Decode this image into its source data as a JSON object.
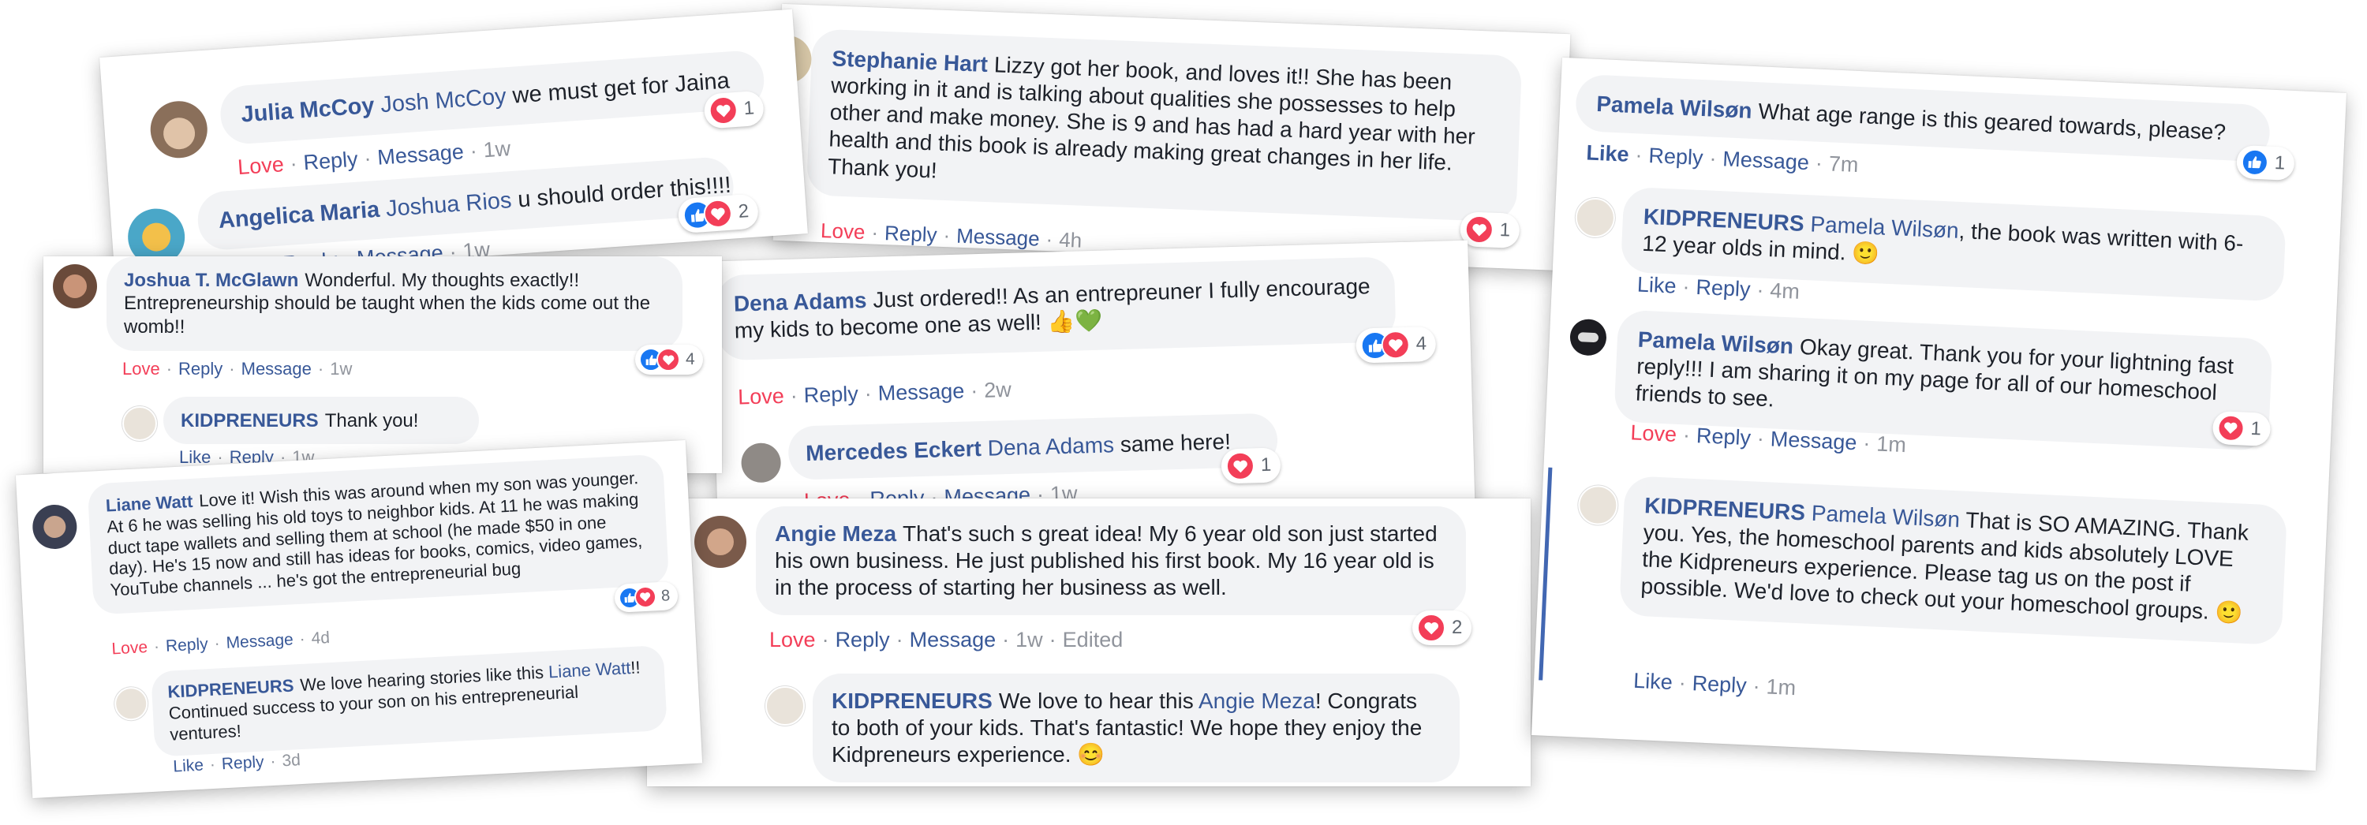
{
  "colors": {
    "name": "#385898",
    "love": "#f33e58",
    "like": "#1877f2",
    "bubble": "#f2f3f5",
    "meta": "#90949c"
  },
  "actions": {
    "love": "Love",
    "like": "Like",
    "reply": "Reply",
    "message": "Message",
    "edited": "Edited",
    "sep": "·"
  },
  "emoji": {
    "smile": "🙂",
    "thumbs_up": "👍",
    "green_heart": "💚",
    "grin": "😊"
  },
  "card1": {
    "c1": {
      "name": "Julia McCoy",
      "tag": "Josh McCoy",
      "text": "we must get for Jaina",
      "time": "1w",
      "count": "1"
    },
    "c2": {
      "name": "Angelica Maria",
      "tag": "Joshua Rios",
      "text": "u should order this!!!!",
      "time": "1w",
      "count": "2"
    }
  },
  "card2": {
    "c1": {
      "name": "Stephanie Hart",
      "text": "Lizzy got her book, and loves it!! She has been working in it and is talking about qualities she possesses to help other and make money. She is 9 and has had a hard year with her health and this book is already making great changes in her life. Thank you!",
      "time": "4h",
      "count": "1"
    }
  },
  "card3": {
    "c1": {
      "name": "Joshua T. McGlawn",
      "text": "Wonderful. My thoughts exactly!! Entrepreneurship should be taught when the kids come out the womb!!",
      "time": "1w",
      "count": "4"
    },
    "r1": {
      "name": "KIDPRENEURS",
      "text": "Thank you!",
      "time": "1w"
    }
  },
  "card4": {
    "c1": {
      "name": "Dena Adams",
      "text": "Just ordered!! As an entrepreuner I fully encourage my kids to become one as well!",
      "time": "2w",
      "count": "4"
    },
    "r1": {
      "name": "Mercedes Eckert",
      "tag": "Dena Adams",
      "text": "same here!",
      "time": "1w",
      "count": "1"
    }
  },
  "card5": {
    "c1": {
      "name": "Liane Watt",
      "text": "Love it! Wish this was around when my son was younger. At 6 he was selling his old toys to neighbor kids. At 11 he was making duct tape wallets and selling them at school (he made $50 in one day). He's 15 now and still has ideas for books, comics, video games, YouTube channels ... he's got the entrepreneurial bug",
      "time": "4d",
      "count": "8"
    },
    "r1": {
      "name": "KIDPRENEURS",
      "text_a": "We love hearing stories like this",
      "tag": "Liane Watt",
      "text_b": "!! Continued success to your son on his entrepreneurial ventures!",
      "time": "3d"
    }
  },
  "card6": {
    "c1": {
      "name": "Angie Meza",
      "text": "That's such s great idea! My 6 year old son just started his own business. He just published his first book. My 16 year old is in the process of starting her business as well.",
      "time": "1w",
      "count": "2"
    },
    "r1": {
      "name": "KIDPRENEURS",
      "text_a": "We love to hear this",
      "tag": "Angie Meza",
      "text_b": "! Congrats to both of your kids. That's fantastic! We hope they enjoy the Kidpreneurs experience.",
      "time": ""
    }
  },
  "card7": {
    "c1": {
      "name": "Pamela Wilsøn",
      "text": "What age range is this geared towards, please?",
      "time": "7m",
      "count": "1"
    },
    "r1": {
      "name": "KIDPRENEURS",
      "tag": "Pamela Wilsøn",
      "text": ", the book was written with 6-12 year olds in mind.",
      "time": "4m"
    },
    "r2": {
      "name": "Pamela Wilsøn",
      "text": "Okay great. Thank you for your lightning fast reply!!! I am sharing it on my page for all of our homeschool friends to see.",
      "time": "1m",
      "count": "1"
    },
    "r3": {
      "name": "KIDPRENEURS",
      "tag": "Pamela Wilsøn",
      "text": "That is SO AMAZING. Thank you. Yes, the homeschool parents and kids absolutely LOVE the Kidpreneurs experience. Please tag us on the post if possible. We'd love to check out your homeschool groups.",
      "time": "1m"
    }
  }
}
